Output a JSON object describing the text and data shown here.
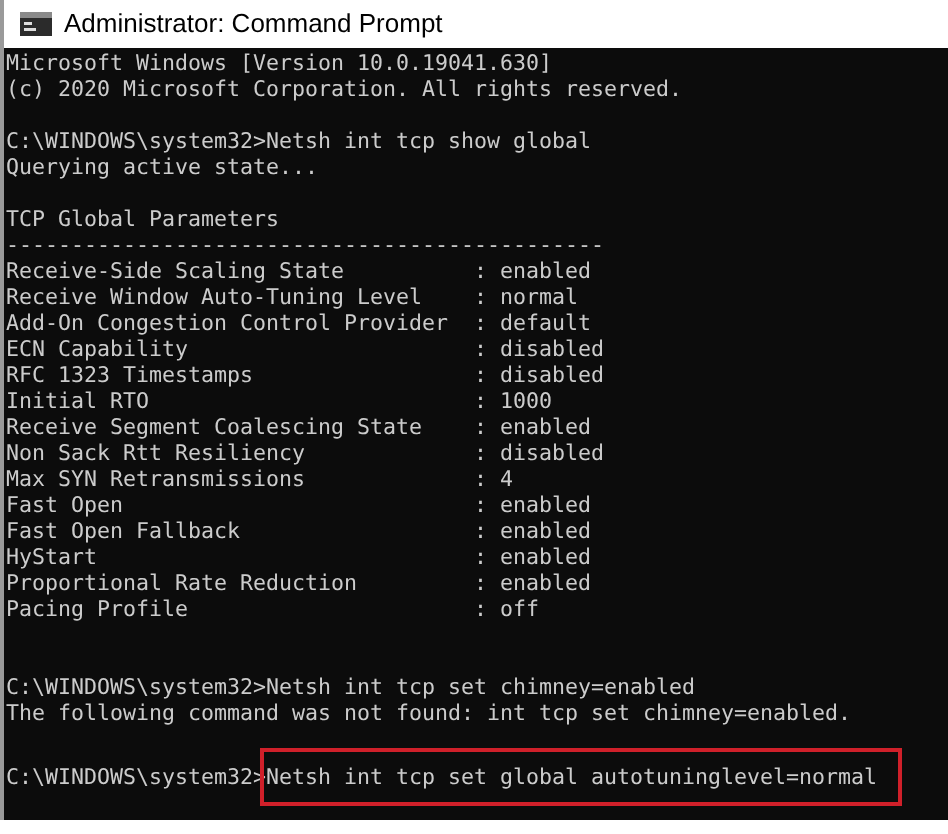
{
  "window": {
    "title": "Administrator: Command Prompt"
  },
  "lines": [
    {
      "kind": "output",
      "text": "Microsoft Windows [Version 10.0.19041.630]"
    },
    {
      "kind": "output",
      "text": "(c) 2020 Microsoft Corporation. All rights reserved."
    },
    {
      "kind": "blank"
    },
    {
      "kind": "command",
      "prompt": "C:\\WINDOWS\\system32>",
      "command": "Netsh int tcp show global",
      "highlighted": false
    },
    {
      "kind": "output",
      "text": "Querying active state..."
    },
    {
      "kind": "blank"
    },
    {
      "kind": "output",
      "text": "TCP Global Parameters"
    },
    {
      "kind": "output",
      "text": "----------------------------------------------"
    },
    {
      "kind": "param",
      "name": "Receive-Side Scaling State",
      "value": ": enabled"
    },
    {
      "kind": "param",
      "name": "Receive Window Auto-Tuning Level",
      "value": ": normal"
    },
    {
      "kind": "param",
      "name": "Add-On Congestion Control Provider",
      "value": ": default"
    },
    {
      "kind": "param",
      "name": "ECN Capability",
      "value": ": disabled"
    },
    {
      "kind": "param",
      "name": "RFC 1323 Timestamps",
      "value": ": disabled"
    },
    {
      "kind": "param",
      "name": "Initial RTO",
      "value": ": 1000"
    },
    {
      "kind": "param",
      "name": "Receive Segment Coalescing State",
      "value": ": enabled"
    },
    {
      "kind": "param",
      "name": "Non Sack Rtt Resiliency",
      "value": ": disabled"
    },
    {
      "kind": "param",
      "name": "Max SYN Retransmissions",
      "value": ": 4"
    },
    {
      "kind": "param",
      "name": "Fast Open",
      "value": ": enabled"
    },
    {
      "kind": "param",
      "name": "Fast Open Fallback",
      "value": ": enabled"
    },
    {
      "kind": "param",
      "name": "HyStart",
      "value": ": enabled"
    },
    {
      "kind": "param",
      "name": "Proportional Rate Reduction",
      "value": ": enabled"
    },
    {
      "kind": "param",
      "name": "Pacing Profile",
      "value": ": off"
    },
    {
      "kind": "blank"
    },
    {
      "kind": "blank"
    },
    {
      "kind": "command",
      "prompt": "C:\\WINDOWS\\system32>",
      "command": "Netsh int tcp set chimney=enabled",
      "highlighted": false
    },
    {
      "kind": "output",
      "text": "The following command was not found: int tcp set chimney=enabled."
    },
    {
      "kind": "blank"
    },
    {
      "kind": "command",
      "prompt": "C:\\WINDOWS\\system32>",
      "command": "Netsh int tcp set global autotuninglevel=normal",
      "highlighted": true
    }
  ]
}
